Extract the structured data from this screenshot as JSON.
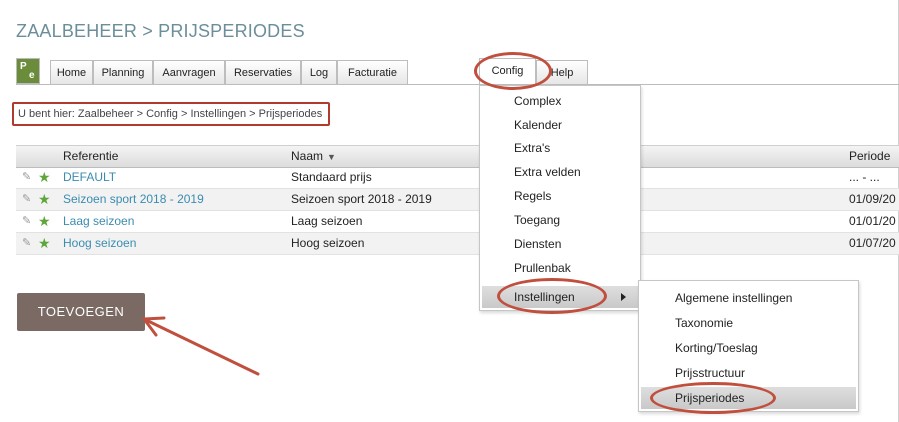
{
  "page_title": "ZAALBEHEER > PRIJSPERIODES",
  "logo": {
    "letters": [
      "P",
      "e"
    ],
    "color": "#6b8c3a"
  },
  "nav": {
    "tabs": [
      "Home",
      "Planning",
      "Aanvragen",
      "Reservaties",
      "Log",
      "Facturatie",
      "Config",
      "Help"
    ],
    "active": "Config"
  },
  "breadcrumb": "U bent hier: Zaalbeheer > Config > Instellingen > Prijsperiodes",
  "table": {
    "headers": {
      "referentie": "Referentie",
      "naam": "Naam",
      "periode": "Periode"
    },
    "sort_indicator": "▼",
    "rows": [
      {
        "referentie": "DEFAULT",
        "naam": "Standaard prijs",
        "periode": "... - ..."
      },
      {
        "referentie": "Seizoen sport 2018 - 2019",
        "naam": "Seizoen sport 2018 - 2019",
        "periode": "01/09/20"
      },
      {
        "referentie": "Laag seizoen",
        "naam": "Laag seizoen",
        "periode": "01/01/20"
      },
      {
        "referentie": "Hoog seizoen",
        "naam": "Hoog seizoen",
        "periode": "01/07/20"
      }
    ]
  },
  "add_button": "TOEVOEGEN",
  "config_menu": {
    "items": [
      "Complex",
      "Kalender",
      "Extra's",
      "Extra velden",
      "Regels",
      "Toegang",
      "Diensten",
      "Prullenbak",
      "Instellingen"
    ],
    "selected": "Instellingen"
  },
  "instellingen_submenu": {
    "items": [
      "Algemene instellingen",
      "Taxonomie",
      "Korting/Toeslag",
      "Prijsstructuur",
      "Prijsperiodes"
    ],
    "selected": "Prijsperiodes"
  },
  "colors": {
    "highlight": "#c0503d",
    "link": "#3a8cb0",
    "title": "#6b8e9a",
    "button": "#7a6a63",
    "star": "#5da63a"
  },
  "icons": [
    "pencil-icon",
    "star-icon",
    "chevron-right-icon",
    "sort-down-icon",
    "arrow-annotation"
  ]
}
